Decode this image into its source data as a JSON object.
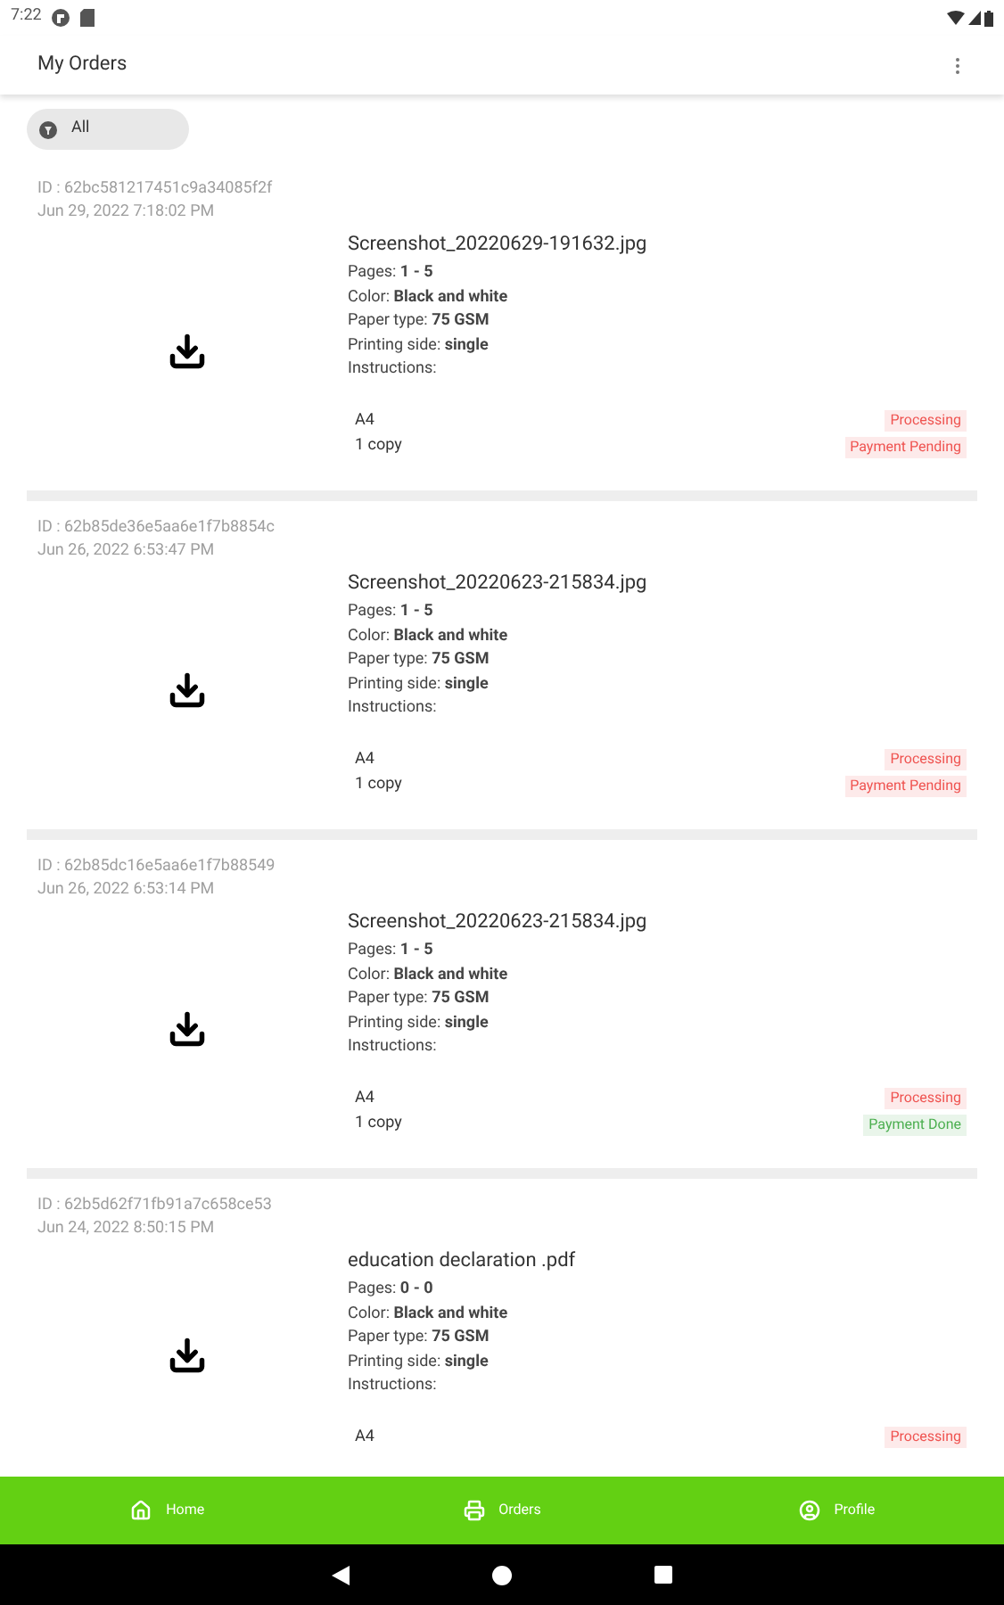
{
  "status_bar": {
    "time": "7:22"
  },
  "app_bar": {
    "title": "My Orders"
  },
  "filter_chip": {
    "label": "All"
  },
  "orders": [
    {
      "id": "ID : 62bc581217451c9a34085f2f",
      "date": "Jun 29, 2022 7:18:02 PM",
      "file": "Screenshot_20220629-191632.jpg",
      "details": [
        "Pages: **1 - 5**",
        "Color: **Black and white**",
        "Paper type: **75 GSM**",
        "Printing side: **single**",
        "Instructions:"
      ],
      "size": "A4",
      "copies": "1 copy",
      "badges": [
        {
          "label": "Processing",
          "color": "#ef5350"
        },
        {
          "label": "Payment Pending",
          "color": "#ef5350"
        }
      ]
    },
    {
      "id": "ID : 62b85de36e5aa6e1f7b8854c",
      "date": "Jun 26, 2022 6:53:47 PM",
      "file": "Screenshot_20220623-215834.jpg",
      "details": [
        "Pages: **1 - 5**",
        "Color: **Black and white**",
        "Paper type: **75 GSM**",
        "Printing side: **single**",
        "Instructions:"
      ],
      "size": "A4",
      "copies": "1 copy",
      "badges": [
        {
          "label": "Processing",
          "color": "#ef5350"
        },
        {
          "label": "Payment Pending",
          "color": "#ef5350"
        }
      ]
    },
    {
      "id": "ID : 62b85dc16e5aa6e1f7b88549",
      "date": "Jun 26, 2022 6:53:14 PM",
      "file": "Screenshot_20220623-215834.jpg",
      "details": [
        "Pages: **1 - 5**",
        "Color: **Black and white**",
        "Paper type: **75 GSM**",
        "Printing side: **single**",
        "Instructions:"
      ],
      "size": "A4",
      "copies": "1 copy",
      "badges": [
        {
          "label": "Processing",
          "color": "#ef5350"
        },
        {
          "label": "Payment Done",
          "color": "#4caf50"
        }
      ]
    },
    {
      "id": "ID : 62b5d62f71fb91a7c658ce53",
      "date": "Jun 24, 2022 8:50:15 PM",
      "file": "education declaration .pdf",
      "details": [
        "Pages: **0 - 0**",
        "Color: **Black and white**",
        "Paper type: **75 GSM**",
        "Printing side: **single**",
        "Instructions:"
      ],
      "size": "A4",
      "badges": [
        {
          "label": "Processing",
          "color": "#ef5350"
        }
      ]
    }
  ],
  "bottom_nav": [
    {
      "label": "Home",
      "kind": "home"
    },
    {
      "label": "Orders",
      "kind": "orders"
    },
    {
      "label": "Profile",
      "kind": "profile"
    }
  ]
}
